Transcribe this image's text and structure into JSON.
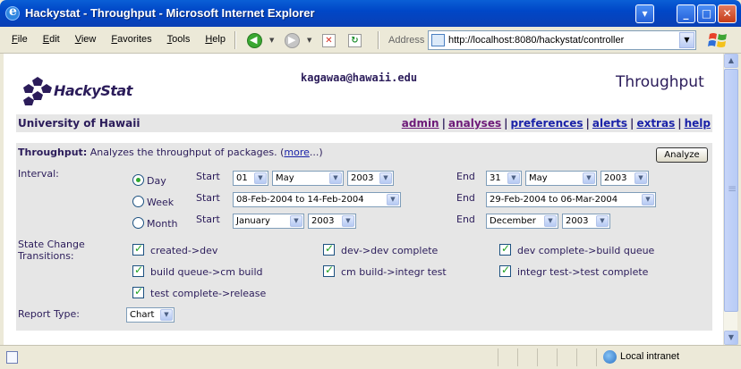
{
  "window": {
    "title": "Hackystat - Throughput - Microsoft Internet Explorer"
  },
  "menu": [
    "File",
    "Edit",
    "View",
    "Favorites",
    "Tools",
    "Help"
  ],
  "address": {
    "label": "Address",
    "url": "http://localhost:8080/hackystat/controller"
  },
  "page": {
    "logo_text": "HackyStat",
    "user_email": "kagawaa@hawaii.edu",
    "heading": "Throughput",
    "organization": "University of Hawaii",
    "nav_links": [
      {
        "label": "admin",
        "visited": true
      },
      {
        "label": "analyses",
        "visited": true
      },
      {
        "label": "preferences",
        "visited": false
      },
      {
        "label": "alerts",
        "visited": false
      },
      {
        "label": "extras",
        "visited": false
      },
      {
        "label": "help",
        "visited": false
      }
    ],
    "nav_separator": "|",
    "analysis": {
      "name": "Throughput:",
      "description": " Analyzes the throughput of packages. (",
      "more_link": "more",
      "more_suffix": "...)",
      "analyze_button": "Analyze"
    },
    "interval": {
      "label": "Interval:",
      "options": [
        "Day",
        "Week",
        "Month"
      ],
      "selected": "Day",
      "start_label": "Start",
      "end_label": "End",
      "day": {
        "start_day": "01",
        "start_month": "May",
        "start_year": "2003",
        "end_day": "31",
        "end_month": "May",
        "end_year": "2003"
      },
      "week": {
        "start": "08-Feb-2004 to 14-Feb-2004",
        "end": "29-Feb-2004 to 06-Mar-2004"
      },
      "month": {
        "start_month": "January",
        "start_year": "2003",
        "end_month": "December",
        "end_year": "2003"
      }
    },
    "transitions": {
      "label_line1": "State Change",
      "label_line2": "Transitions:",
      "items": [
        {
          "label": "created->dev",
          "checked": true
        },
        {
          "label": "dev->dev complete",
          "checked": true
        },
        {
          "label": "dev complete->build queue",
          "checked": true
        },
        {
          "label": "build queue->cm build",
          "checked": true
        },
        {
          "label": "cm build->integr test",
          "checked": true
        },
        {
          "label": "integr test->test complete",
          "checked": true
        },
        {
          "label": "test complete->release",
          "checked": true
        }
      ]
    },
    "report_type": {
      "label": "Report Type:",
      "value": "Chart"
    }
  },
  "status": {
    "zone": "Local intranet"
  }
}
